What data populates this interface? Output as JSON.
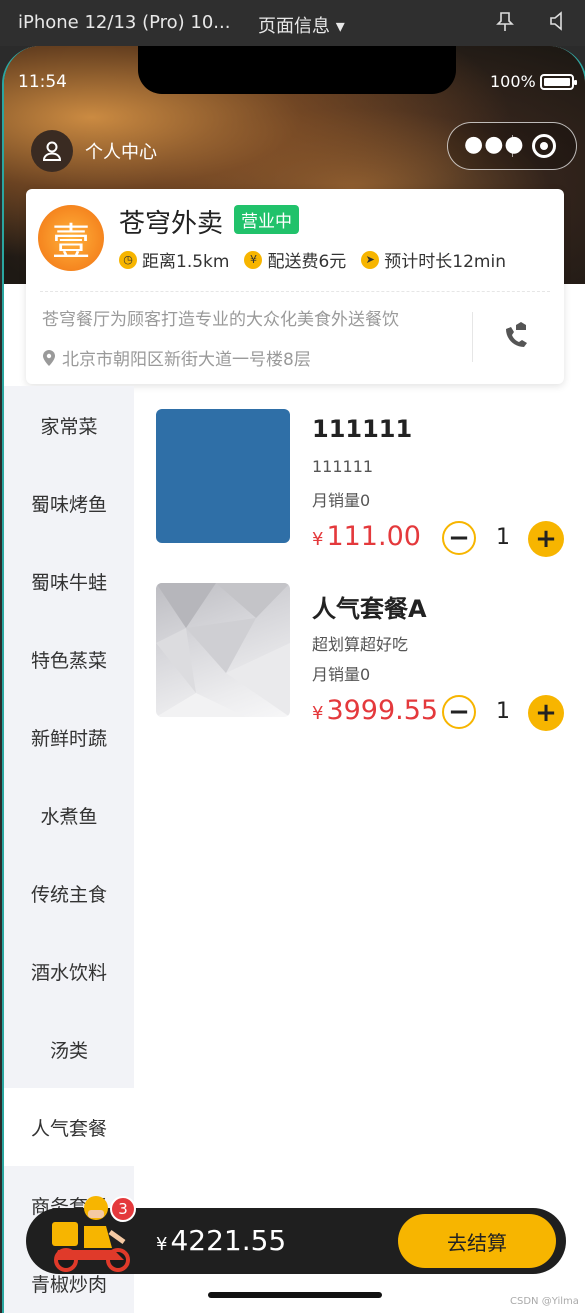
{
  "toolbar": {
    "device": "iPhone 12/13 (Pro) 10...",
    "page_info": "页面信息 ▾"
  },
  "statusbar": {
    "time": "11:54",
    "battery": "100%"
  },
  "nav": {
    "user_center": "个人中心"
  },
  "shop": {
    "logo_char": "壹",
    "name": "苍穹外卖",
    "status": "营业中",
    "distance": "距离1.5km",
    "delivery_fee": "配送费6元",
    "eta": "预计时长12min",
    "description": "苍穹餐厅为顾客打造专业的大众化美食外送餐饮",
    "address": "北京市朝阳区新街大道一号楼8层"
  },
  "categories": [
    "家常菜",
    "蜀味烤鱼",
    "蜀味牛蛙",
    "特色蒸菜",
    "新鲜时蔬",
    "水煮鱼",
    "传统主食",
    "酒水饮料",
    "汤类",
    "人气套餐",
    "商务套餐",
    "青椒炒肉"
  ],
  "active_category": "人气套餐",
  "dishes": [
    {
      "title": "111111",
      "sub": "111111",
      "sold": "月销量0",
      "currency": "¥",
      "price": "111.00",
      "qty": "1",
      "image_color": "#2f6fa7"
    },
    {
      "title": "人气套餐A",
      "sub": "超划算超好吃",
      "sold": "月销量0",
      "currency": "¥",
      "price": "3999.55",
      "qty": "1",
      "image_color": "#d4d4d8"
    }
  ],
  "cart": {
    "count": "3",
    "currency": "¥",
    "total": "4221.55",
    "checkout": "去结算"
  },
  "watermark": "CSDN @Yilma",
  "colors": {
    "accent": "#f7b500",
    "price": "#e4393c",
    "open": "#21c26b"
  }
}
